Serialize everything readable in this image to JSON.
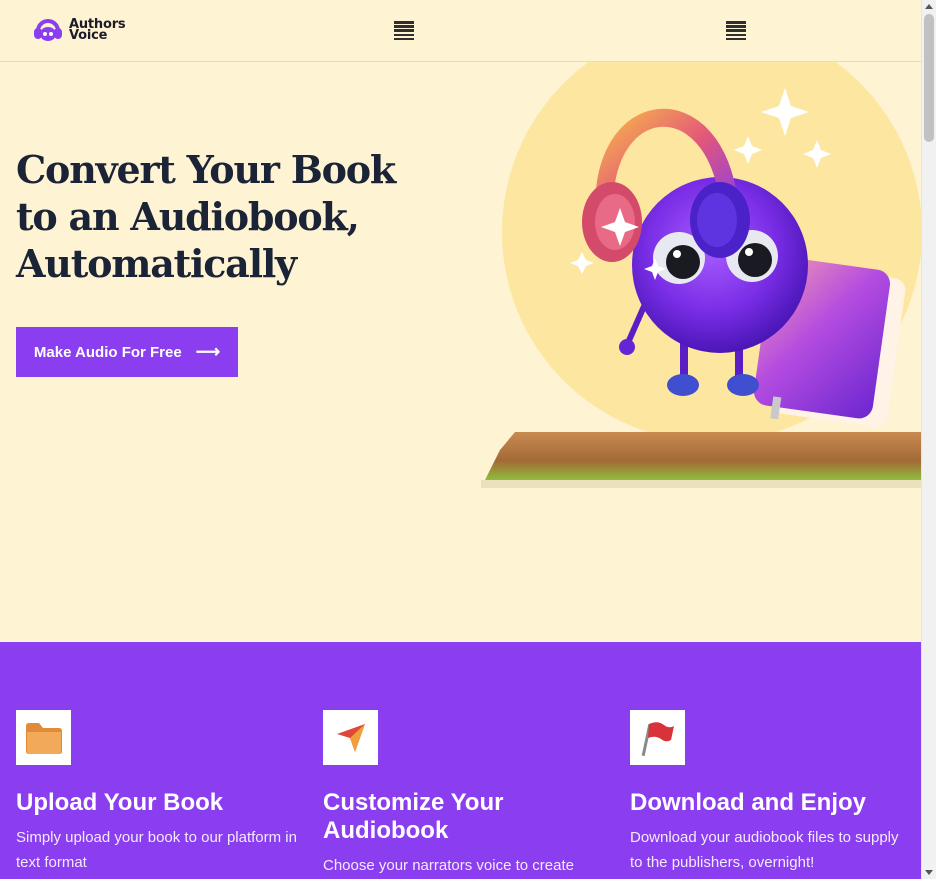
{
  "header": {
    "logo_line1": "Authors",
    "logo_line2": "Voice",
    "menu_icon_1": "hamburger-menu-icon",
    "menu_icon_2": "hamburger-menu-icon"
  },
  "hero": {
    "title": "Convert Your Book to an Audiobook, Automatically",
    "cta_label": "Make Audio For Free",
    "cta_icon": "arrow-right-icon",
    "illustration": "purple-fluffy-character-with-headphones-and-book"
  },
  "features": [
    {
      "icon": "folder-icon",
      "title": "Upload Your Book",
      "desc": "Simply upload your book to our platform in text format"
    },
    {
      "icon": "cursor-arrow-icon",
      "title": "Customize Your Audiobook",
      "desc": "Choose your narrators voice to create"
    },
    {
      "icon": "flag-icon",
      "title": "Download and Enjoy",
      "desc": "Download your audiobook files to supply to the publishers, overnight!"
    }
  ],
  "colors": {
    "accent": "#8b3df0",
    "background": "#fef3d3",
    "heading": "#1b2336"
  }
}
